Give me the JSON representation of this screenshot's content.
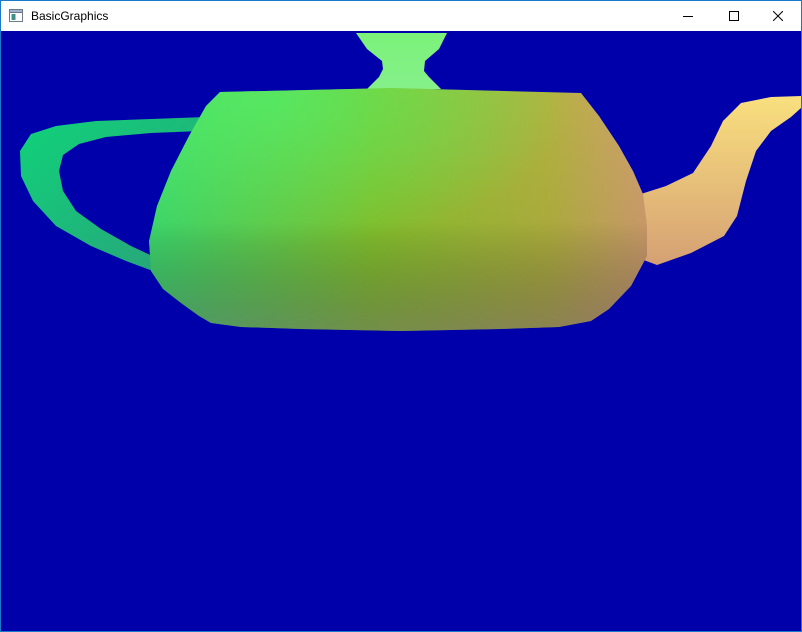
{
  "window": {
    "title": "BasicGraphics",
    "icon": "app-window-icon",
    "border_color": "#1979ca"
  },
  "caption_buttons": [
    {
      "name": "minimize",
      "icon": "minimize-icon"
    },
    {
      "name": "maximize",
      "icon": "maximize-icon"
    },
    {
      "name": "close",
      "icon": "close-icon"
    }
  ],
  "viewport": {
    "background_color": "#0000aa",
    "object": "teapot-rendering",
    "colors": {
      "handle": "#10d27a",
      "lid": "#7bf27a",
      "body_top_left": "#49e65a",
      "body_center": "#8ab324",
      "body_bottom": "#7e7e62",
      "spout": "#f5d77e",
      "body_right": "#d49a6c"
    }
  }
}
